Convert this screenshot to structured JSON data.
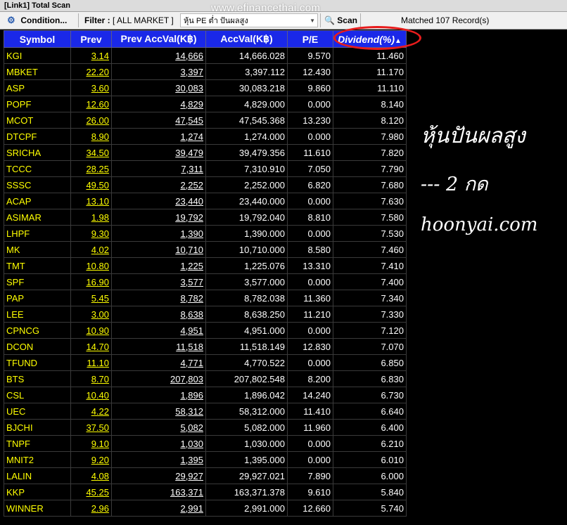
{
  "window": {
    "title": "[Link1] Total Scan"
  },
  "toolbar": {
    "condition_label": "Condition...",
    "filter_label": "Filter :",
    "filter_value": "[ ALL MARKET ]",
    "preset_value": "หุ้น PE ต่ำ ปันผลสูง",
    "scan_label": "Scan",
    "matched_text": "Matched 107 Record(s)"
  },
  "watermark": "www.efinancethai.com",
  "table": {
    "headers": [
      "Symbol",
      "Prev",
      "Prev AccVal(K฿)",
      "AccVal(K฿)",
      "P/E",
      "Dividend(%)"
    ],
    "sort_indicator": "▲",
    "rows": [
      [
        "KGI",
        "3.14",
        "14,666",
        "14,666.028",
        "9.570",
        "11.460"
      ],
      [
        "MBKET",
        "22.20",
        "3,397",
        "3,397.112",
        "12.430",
        "11.170"
      ],
      [
        "ASP",
        "3.60",
        "30,083",
        "30,083.218",
        "9.860",
        "11.110"
      ],
      [
        "POPF",
        "12.60",
        "4,829",
        "4,829.000",
        "0.000",
        "8.140"
      ],
      [
        "MCOT",
        "26.00",
        "47,545",
        "47,545.368",
        "13.230",
        "8.120"
      ],
      [
        "DTCPF",
        "8.90",
        "1,274",
        "1,274.000",
        "0.000",
        "7.980"
      ],
      [
        "SRICHA",
        "34.50",
        "39,479",
        "39,479.356",
        "11.610",
        "7.820"
      ],
      [
        "TCCC",
        "28.25",
        "7,311",
        "7,310.910",
        "7.050",
        "7.790"
      ],
      [
        "SSSC",
        "49.50",
        "2,252",
        "2,252.000",
        "6.820",
        "7.680"
      ],
      [
        "ACAP",
        "13.10",
        "23,440",
        "23,440.000",
        "0.000",
        "7.630"
      ],
      [
        "ASIMAR",
        "1.98",
        "19,792",
        "19,792.040",
        "8.810",
        "7.580"
      ],
      [
        "LHPF",
        "9.30",
        "1,390",
        "1,390.000",
        "0.000",
        "7.530"
      ],
      [
        "MK",
        "4.02",
        "10,710",
        "10,710.000",
        "8.580",
        "7.460"
      ],
      [
        "TMT",
        "10.80",
        "1,225",
        "1,225.076",
        "13.310",
        "7.410"
      ],
      [
        "SPF",
        "16.90",
        "3,577",
        "3,577.000",
        "0.000",
        "7.400"
      ],
      [
        "PAP",
        "5.45",
        "8,782",
        "8,782.038",
        "11.360",
        "7.340"
      ],
      [
        "LEE",
        "3.00",
        "8,638",
        "8,638.250",
        "11.210",
        "7.330"
      ],
      [
        "CPNCG",
        "10.90",
        "4,951",
        "4,951.000",
        "0.000",
        "7.120"
      ],
      [
        "DCON",
        "14.70",
        "11,518",
        "11,518.149",
        "12.830",
        "7.070"
      ],
      [
        "TFUND",
        "11.10",
        "4,771",
        "4,770.522",
        "0.000",
        "6.850"
      ],
      [
        "BTS",
        "8.70",
        "207,803",
        "207,802.548",
        "8.200",
        "6.830"
      ],
      [
        "CSL",
        "10.40",
        "1,896",
        "1,896.042",
        "14.240",
        "6.730"
      ],
      [
        "UEC",
        "4.22",
        "58,312",
        "58,312.000",
        "11.410",
        "6.640"
      ],
      [
        "BJCHI",
        "37.50",
        "5,082",
        "5,082.000",
        "11.960",
        "6.400"
      ],
      [
        "TNPF",
        "9.10",
        "1,030",
        "1,030.000",
        "0.000",
        "6.210"
      ],
      [
        "MNIT2",
        "9.20",
        "1,395",
        "1,395.000",
        "0.000",
        "6.010"
      ],
      [
        "LALIN",
        "4.08",
        "29,927",
        "29,927.021",
        "7.890",
        "6.000"
      ],
      [
        "KKP",
        "45.25",
        "163,371",
        "163,371.378",
        "9.610",
        "5.840"
      ],
      [
        "WINNER",
        "2.96",
        "2,991",
        "2,991.000",
        "12.660",
        "5.740"
      ]
    ]
  },
  "annotation": {
    "line1": "หุ้นปันผลสูง",
    "line2": "--- 2 กด",
    "line3": "hoonyai.com"
  },
  "colors": {
    "header_bg": "#1a28e8",
    "symbol_text": "#ffff00",
    "highlight_oval": "#e81c1c"
  }
}
